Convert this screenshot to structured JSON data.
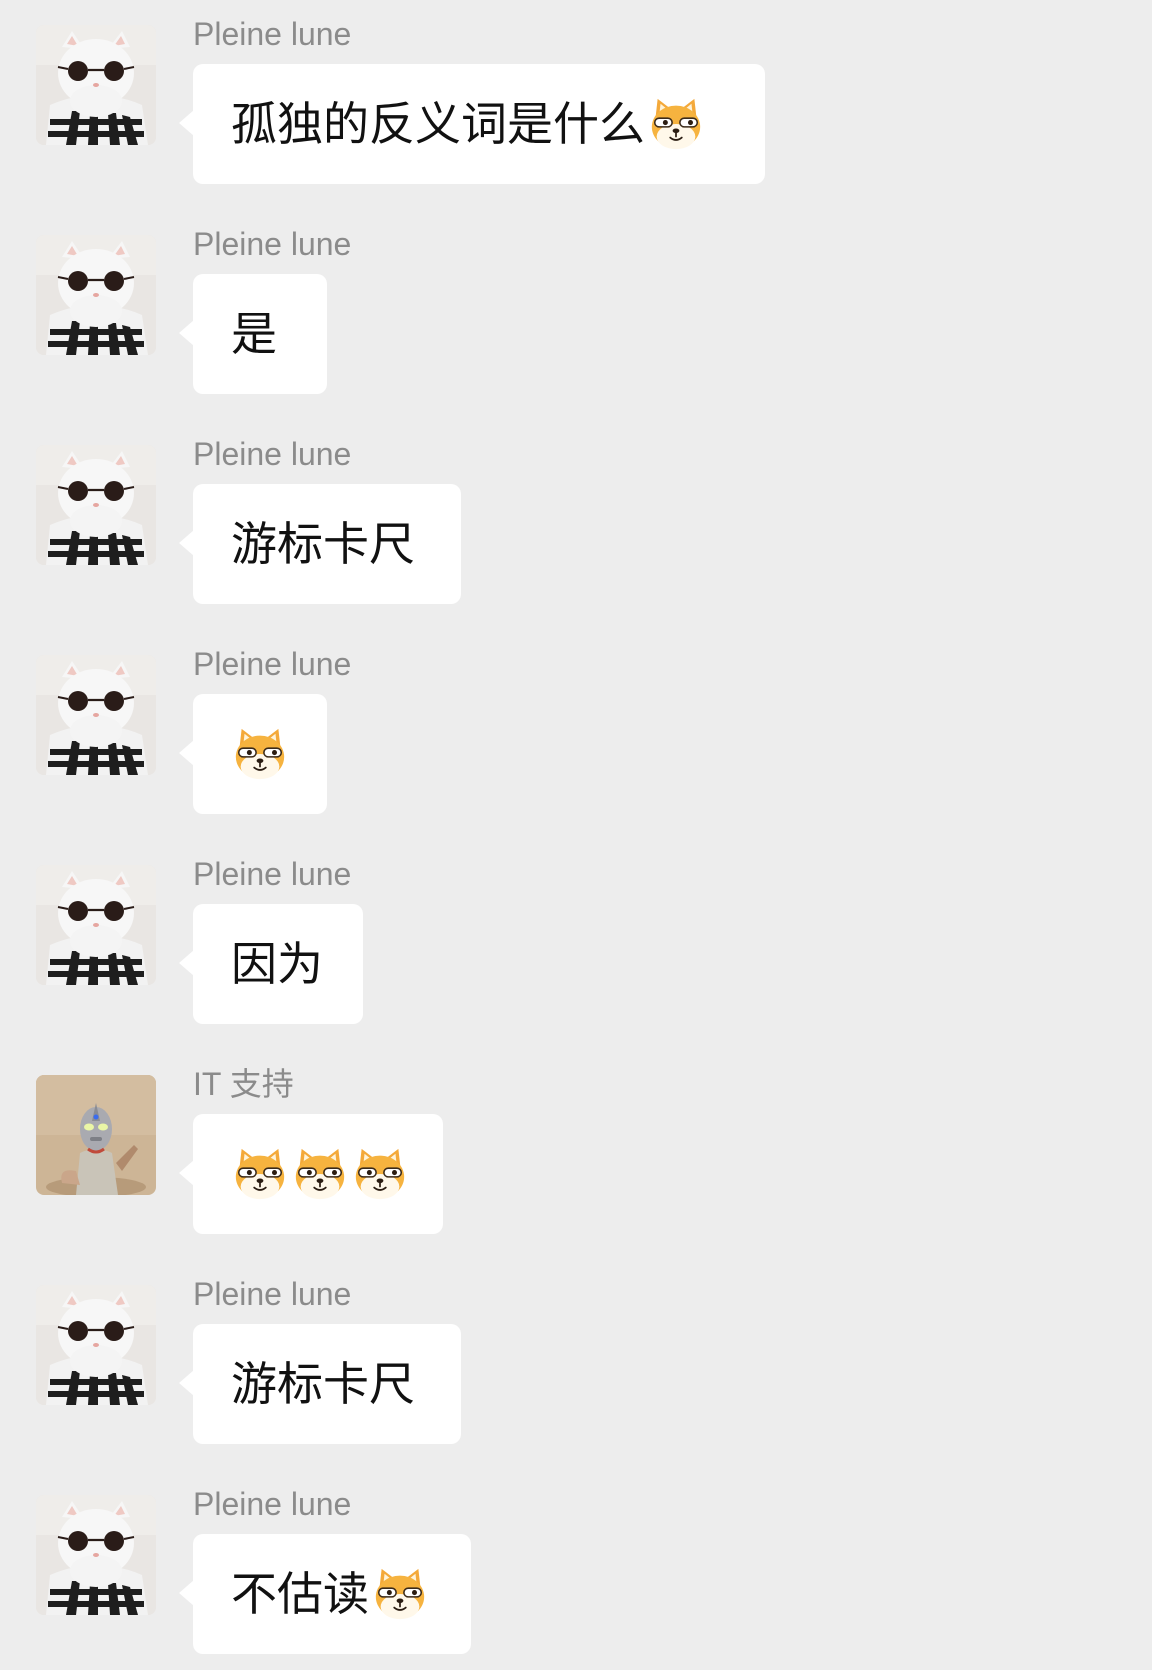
{
  "chat": {
    "messages": [
      {
        "sender": "Pleine lune",
        "avatar_icon": "cat-with-sunglasses-avatar",
        "text": "孤独的反义词是什么",
        "emoji_count": 1
      },
      {
        "sender": "Pleine lune",
        "avatar_icon": "cat-with-sunglasses-avatar",
        "text": "是",
        "emoji_count": 0
      },
      {
        "sender": "Pleine lune",
        "avatar_icon": "cat-with-sunglasses-avatar",
        "text": "游标卡尺",
        "emoji_count": 0
      },
      {
        "sender": "Pleine lune",
        "avatar_icon": "cat-with-sunglasses-avatar",
        "text": "",
        "emoji_count": 1
      },
      {
        "sender": "Pleine lune",
        "avatar_icon": "cat-with-sunglasses-avatar",
        "text": "因为",
        "emoji_count": 0
      },
      {
        "sender": "IT 支持",
        "avatar_icon": "ultraman-figure-avatar",
        "text": "",
        "emoji_count": 3
      },
      {
        "sender": "Pleine lune",
        "avatar_icon": "cat-with-sunglasses-avatar",
        "text": "游标卡尺",
        "emoji_count": 0
      },
      {
        "sender": "Pleine lune",
        "avatar_icon": "cat-with-sunglasses-avatar",
        "text": "不估读",
        "emoji_count": 1
      }
    ],
    "emoji_icon": "smirking-dog-emoji",
    "colors": {
      "background": "#ededed",
      "bubble": "#ffffff",
      "sender_name": "#8b8b8b",
      "text": "#111111"
    }
  }
}
